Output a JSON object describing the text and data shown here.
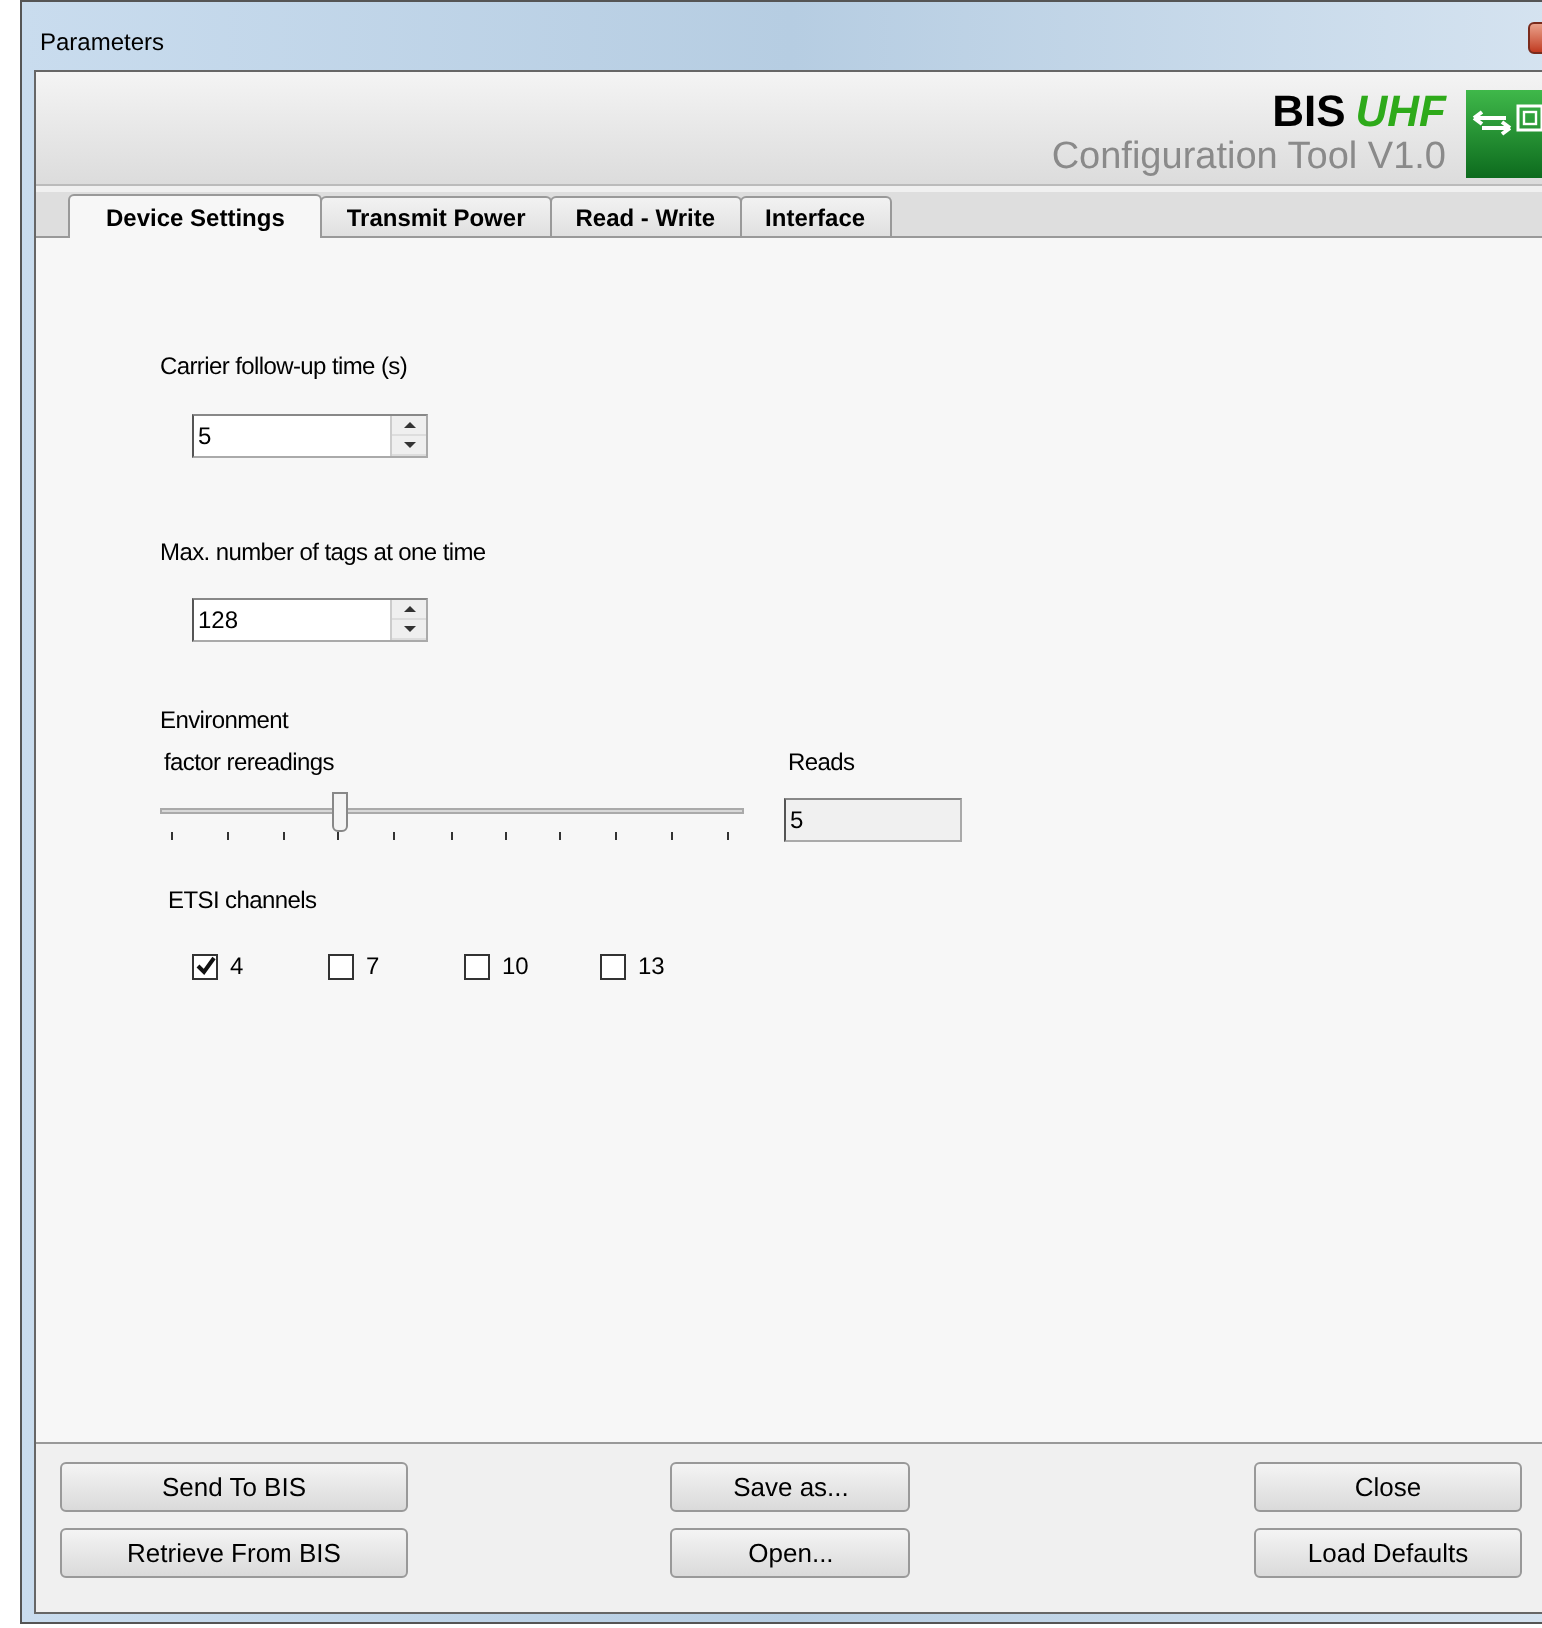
{
  "window": {
    "title": "Parameters"
  },
  "header": {
    "brand": "BIS",
    "brand_suffix": "UHF",
    "subtitle": "Configuration Tool V1.0"
  },
  "tabs": [
    {
      "label": "Device Settings",
      "selected": true
    },
    {
      "label": "Transmit Power",
      "selected": false
    },
    {
      "label": "Read - Write",
      "selected": false
    },
    {
      "label": "Interface",
      "selected": false
    }
  ],
  "carrier_follow_up": {
    "label": "Carrier follow-up time (s)",
    "value": "5"
  },
  "max_tags": {
    "label": "Max. number of tags at one time",
    "value": "128"
  },
  "environment": {
    "label": "Environment",
    "slider_label": "factor rereadings",
    "level": 0.3,
    "reads_label": "Reads",
    "reads_value": "5"
  },
  "etsi_channels": {
    "label": "ETSI channels",
    "items": [
      {
        "label": "4",
        "checked": true
      },
      {
        "label": "7",
        "checked": false
      },
      {
        "label": "10",
        "checked": false
      },
      {
        "label": "13",
        "checked": false
      }
    ]
  },
  "button_columns": [
    [
      "Send To BIS",
      "Retrieve From BIS"
    ],
    [
      "Save as...",
      "Open..."
    ],
    [
      "Close",
      "Load Defaults"
    ]
  ]
}
